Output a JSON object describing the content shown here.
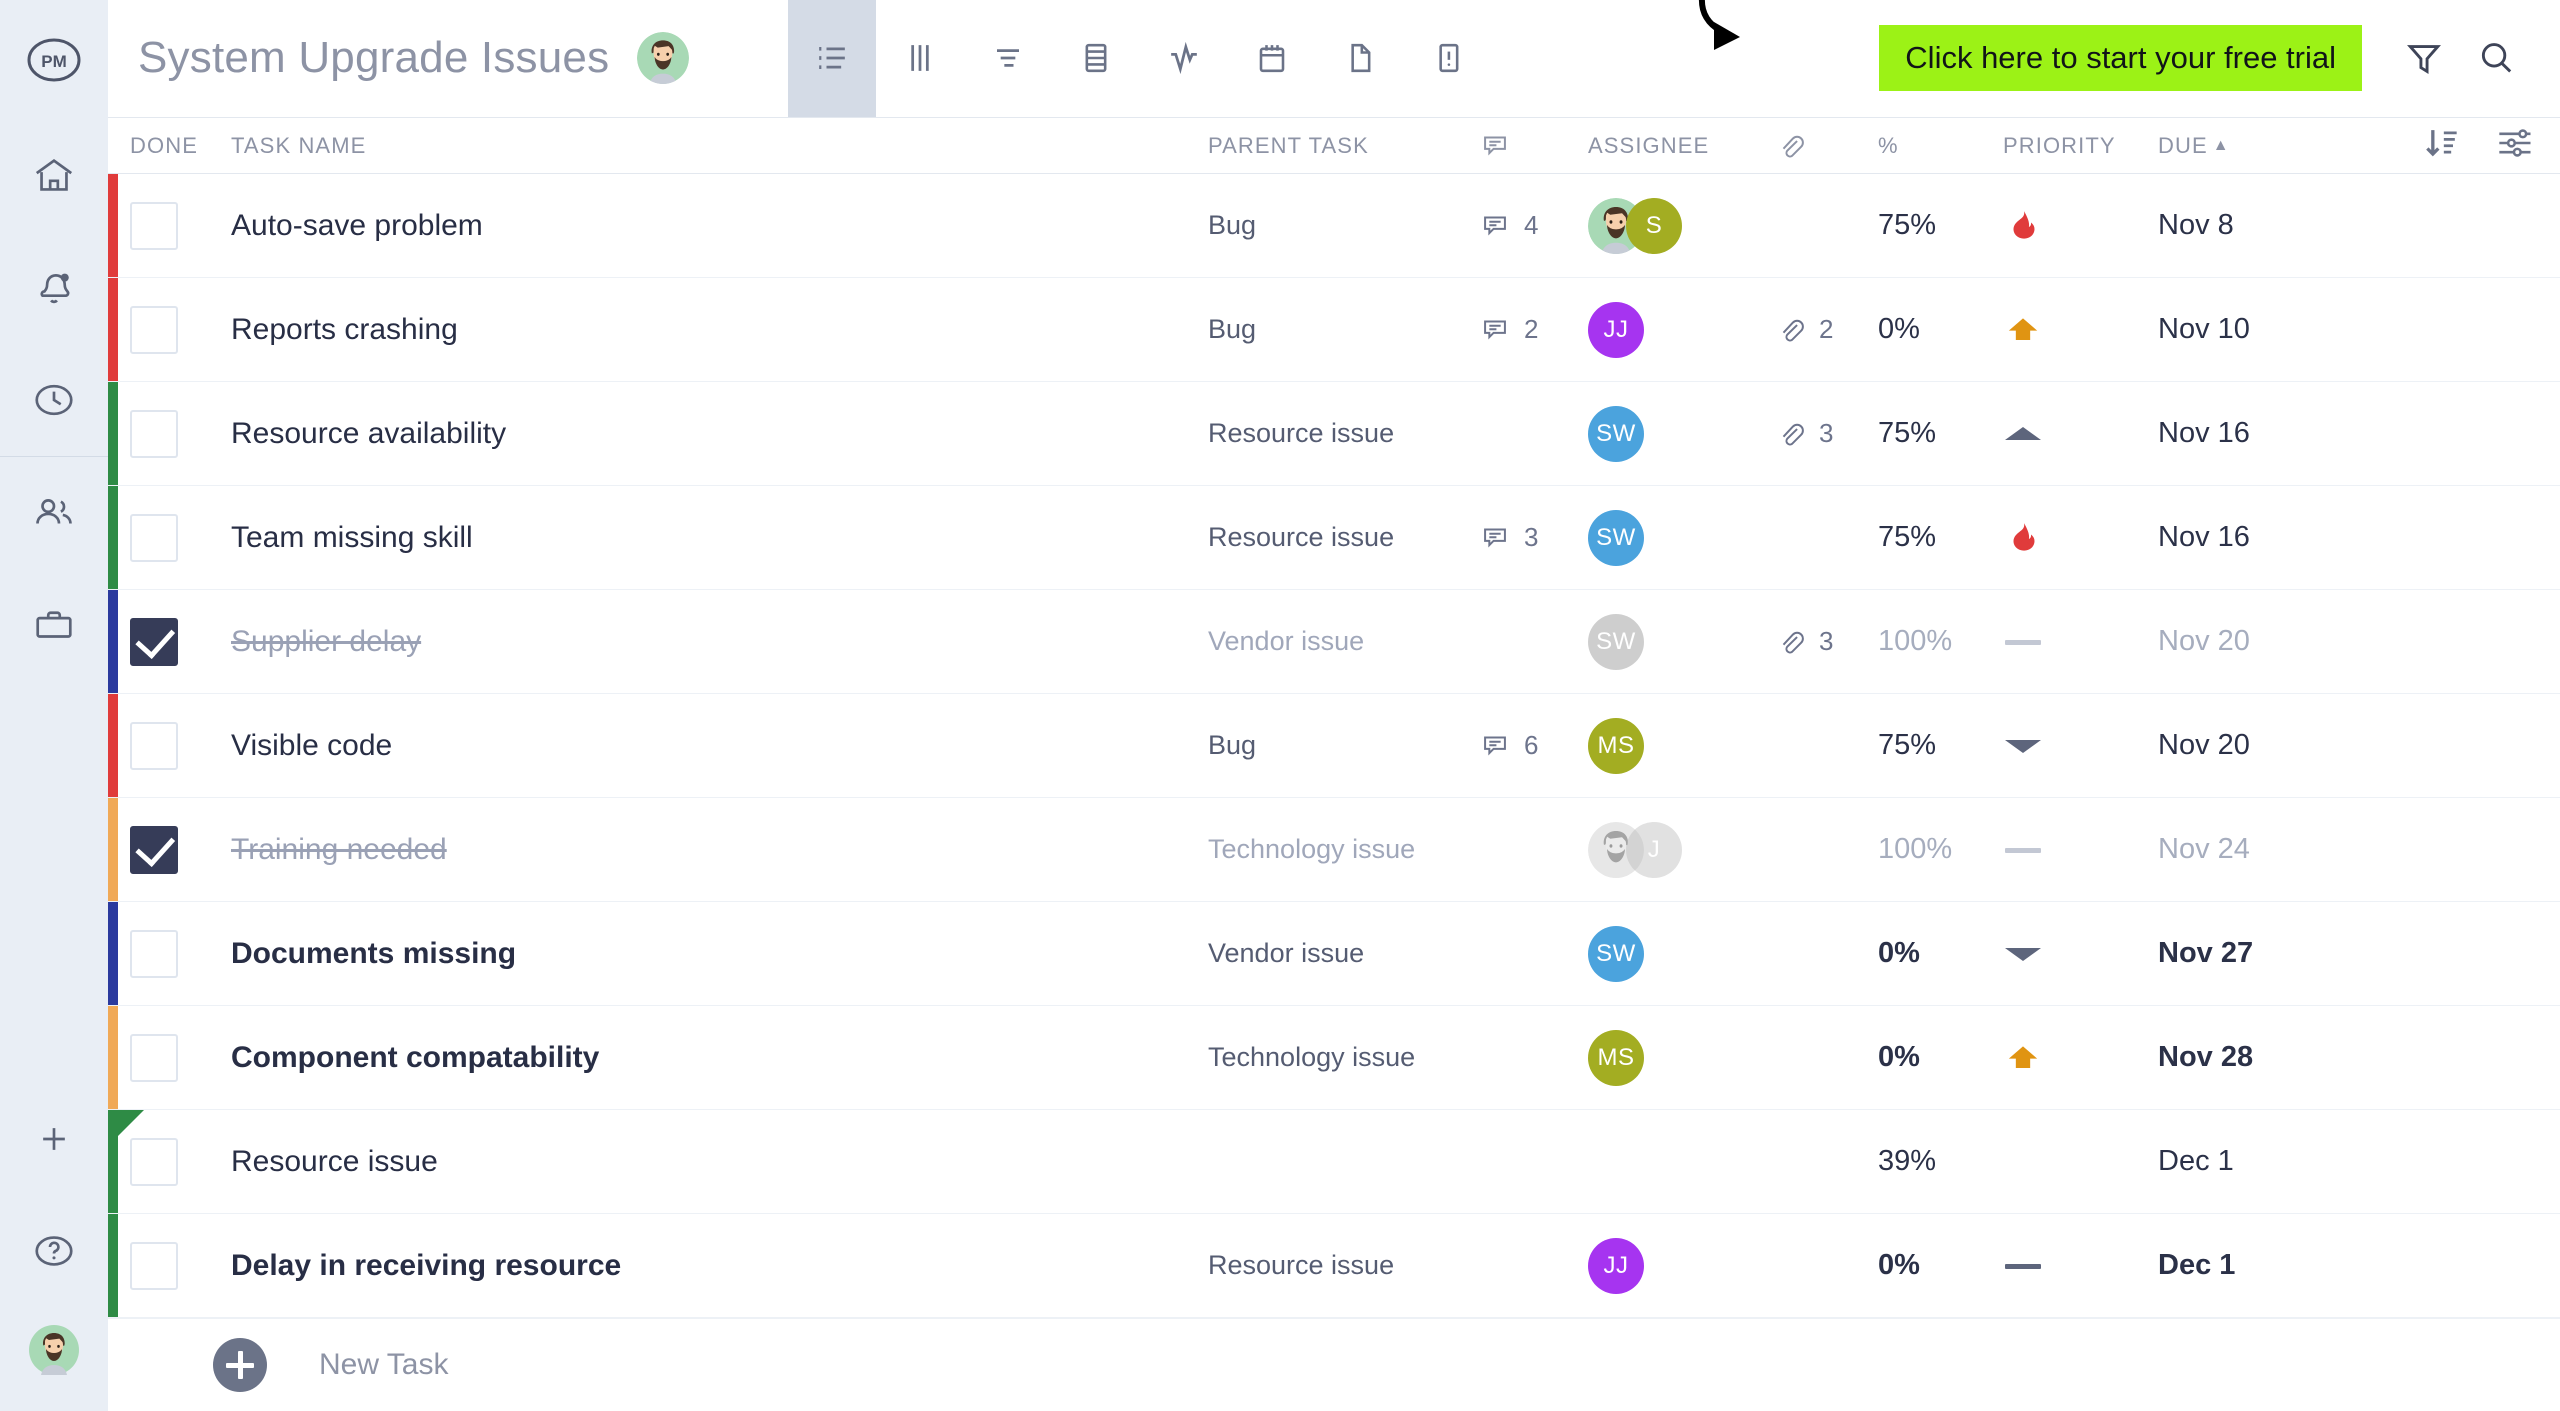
{
  "app": {
    "logo_text": "PM",
    "accent_cta": "#9cf216",
    "checkbox_checked_color": "#363c58"
  },
  "sidebar": {
    "items": [
      {
        "name": "home",
        "label": "Home"
      },
      {
        "name": "notifications",
        "label": "Notifications"
      },
      {
        "name": "timesheets",
        "label": "Timesheets"
      },
      {
        "name": "team",
        "label": "Team"
      },
      {
        "name": "portfolio",
        "label": "Portfolio"
      }
    ],
    "bottom_items": [
      {
        "name": "add",
        "label": "Add"
      },
      {
        "name": "help",
        "label": "Help"
      },
      {
        "name": "account",
        "label": "Account"
      }
    ]
  },
  "header": {
    "title": "System Upgrade Issues",
    "avatar_name": "user-avatar",
    "view_tabs": [
      {
        "icon": "list-icon",
        "label": "List",
        "active": true
      },
      {
        "icon": "board-icon",
        "label": "Board",
        "active": false
      },
      {
        "icon": "gantt-icon",
        "label": "Gantt",
        "active": false
      },
      {
        "icon": "sheet-icon",
        "label": "Sheet",
        "active": false
      },
      {
        "icon": "workload-icon",
        "label": "Workload",
        "active": false
      },
      {
        "icon": "calendar-icon",
        "label": "Calendar",
        "active": false
      },
      {
        "icon": "file-icon",
        "label": "Files",
        "active": false
      },
      {
        "icon": "issues-icon",
        "label": "Issues",
        "active": false
      }
    ],
    "cta_label": "Click here to start your free trial",
    "filter_label": "Filter",
    "search_label": "Search"
  },
  "table": {
    "columns": {
      "done": "DONE",
      "task_name": "TASK NAME",
      "parent_task": "PARENT TASK",
      "comments": "comment-icon",
      "assignee": "ASSIGNEE",
      "attachments": "paperclip-icon",
      "percent": "%",
      "priority": "PRIORITY",
      "due": "DUE",
      "due_sort_indicator": "▲",
      "sort_label": "Sort",
      "settings_label": "Column settings"
    },
    "rows": [
      {
        "bar": "#e03b3b",
        "done": false,
        "name": "Auto-save problem",
        "bold": false,
        "parent": "Bug",
        "comments": "4",
        "attachments": "",
        "assignees": [
          {
            "type": "photo",
            "initials": "",
            "color": "#a8d9b5"
          },
          {
            "type": "initials",
            "initials": "S",
            "color": "#a3ad22"
          }
        ],
        "percent": "75%",
        "priority": "fire",
        "due": "Nov 8"
      },
      {
        "bar": "#e03b3b",
        "done": false,
        "name": "Reports crashing",
        "bold": false,
        "parent": "Bug",
        "comments": "2",
        "attachments": "2",
        "assignees": [
          {
            "type": "initials",
            "initials": "JJ",
            "color": "#a634f0"
          }
        ],
        "percent": "0%",
        "priority": "up",
        "due": "Nov 10"
      },
      {
        "bar": "#2e8b45",
        "done": false,
        "name": "Resource availability",
        "bold": false,
        "parent": "Resource issue",
        "comments": "",
        "attachments": "3",
        "assignees": [
          {
            "type": "initials",
            "initials": "SW",
            "color": "#4ba3dd"
          }
        ],
        "percent": "75%",
        "priority": "chev-up",
        "due": "Nov 16"
      },
      {
        "bar": "#2e8b45",
        "done": false,
        "name": "Team missing skill",
        "bold": false,
        "parent": "Resource issue",
        "comments": "3",
        "attachments": "",
        "assignees": [
          {
            "type": "initials",
            "initials": "SW",
            "color": "#4ba3dd"
          }
        ],
        "percent": "75%",
        "priority": "fire",
        "due": "Nov 16"
      },
      {
        "bar": "#2b3a9e",
        "done": true,
        "name": "Supplier delay",
        "bold": false,
        "parent": "Vendor issue",
        "comments": "",
        "attachments": "3",
        "assignees": [
          {
            "type": "initials",
            "initials": "SW",
            "color": "#4ba3dd",
            "dim": true
          }
        ],
        "percent": "100%",
        "priority": "dash-light",
        "due": "Nov 20"
      },
      {
        "bar": "#e03b3b",
        "done": false,
        "name": "Visible code",
        "bold": false,
        "parent": "Bug",
        "comments": "6",
        "attachments": "",
        "assignees": [
          {
            "type": "initials",
            "initials": "MS",
            "color": "#a3ad22"
          }
        ],
        "percent": "75%",
        "priority": "chev-down",
        "due": "Nov 20"
      },
      {
        "bar": "#f0a957",
        "done": true,
        "name": "Training needed",
        "bold": false,
        "parent": "Technology issue",
        "comments": "",
        "attachments": "",
        "assignees": [
          {
            "type": "photo",
            "initials": "",
            "color": "#bdbdbd",
            "dim": true
          },
          {
            "type": "initials",
            "initials": "J",
            "color": "#bdbdbd",
            "dim": true
          }
        ],
        "percent": "100%",
        "priority": "dash-light",
        "due": "Nov 24"
      },
      {
        "bar": "#2b3a9e",
        "done": false,
        "name": "Documents missing",
        "bold": true,
        "parent": "Vendor issue",
        "comments": "",
        "attachments": "",
        "assignees": [
          {
            "type": "initials",
            "initials": "SW",
            "color": "#4ba3dd"
          }
        ],
        "percent": "0%",
        "priority": "chev-down",
        "due": "Nov 27"
      },
      {
        "bar": "#f0a957",
        "done": false,
        "name": "Component compatability",
        "bold": true,
        "parent": "Technology issue",
        "comments": "",
        "attachments": "",
        "assignees": [
          {
            "type": "initials",
            "initials": "MS",
            "color": "#a3ad22"
          }
        ],
        "percent": "0%",
        "priority": "up",
        "due": "Nov 28"
      },
      {
        "bar": "#2e8b45",
        "corner": true,
        "done": false,
        "name": "Resource issue",
        "bold": false,
        "parent": "",
        "comments": "",
        "attachments": "",
        "assignees": [],
        "percent": "39%",
        "priority": "none",
        "due": "Dec 1"
      },
      {
        "bar": "#2e8b45",
        "done": false,
        "name": "Delay in receiving resource",
        "bold": true,
        "parent": "Resource issue",
        "comments": "",
        "attachments": "",
        "assignees": [
          {
            "type": "initials",
            "initials": "JJ",
            "color": "#a634f0"
          }
        ],
        "percent": "0%",
        "priority": "dash-dark",
        "due": "Dec 1"
      }
    ],
    "new_task_label": "New Task"
  }
}
